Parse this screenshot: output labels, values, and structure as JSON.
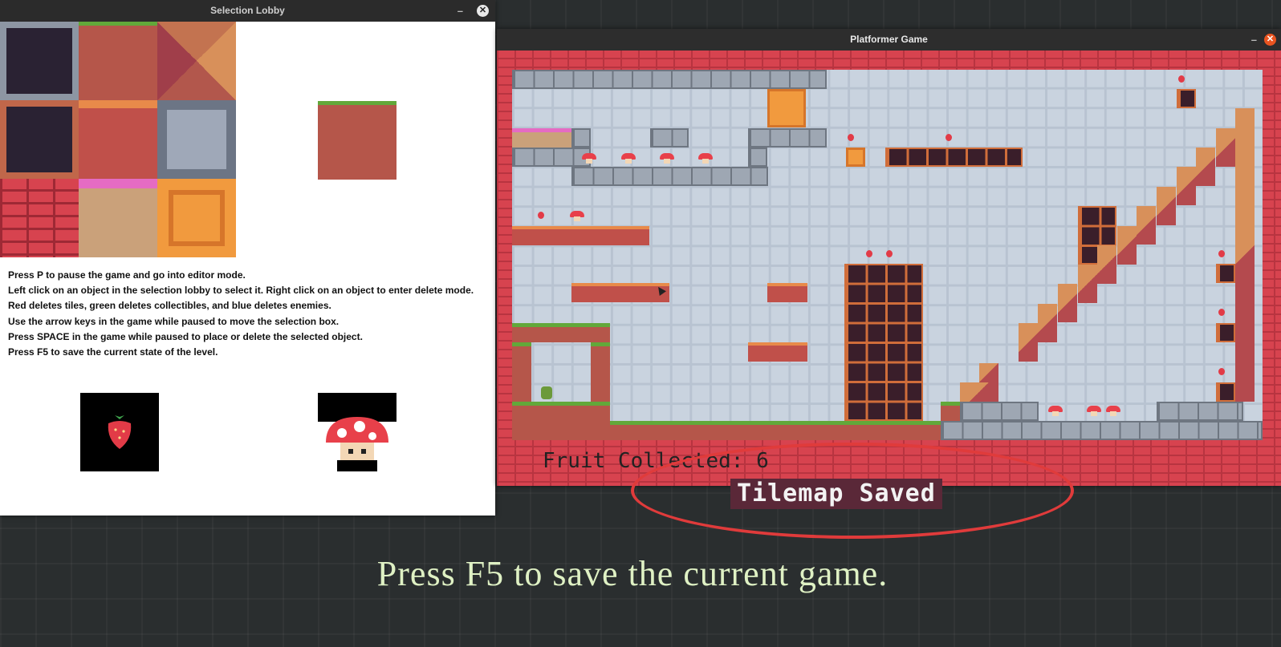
{
  "lobby": {
    "title": "Selection Lobby",
    "minimize": "–",
    "close": "✕",
    "instructions": [
      "Press P to pause the game and go into editor mode.",
      "Left click on an object in the selection lobby to select it. Right click on an object to enter delete mode.",
      "Red deletes tiles, green deletes collectibles, and blue deletes enemies.",
      "Use the arrow keys in the game while paused to move the selection box.",
      "Press SPACE in the game while paused to place or delete the selected object.",
      "Press F5 to save the current state of the level."
    ]
  },
  "game": {
    "title": "Platformer Game",
    "minimize": "–",
    "close": "✕",
    "fruit_label": "Fruit Collected:",
    "fruit_count": "6",
    "status": "Tilemap Saved"
  },
  "caption": "Press F5 to save the current game.",
  "colors": {
    "highlight": "#e03b3b",
    "caption": "#dff1c4"
  }
}
